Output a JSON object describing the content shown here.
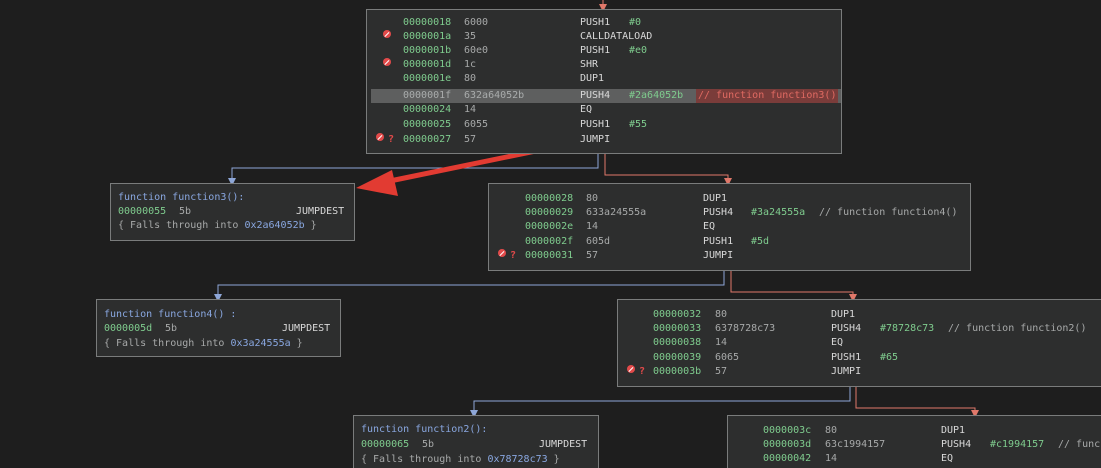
{
  "block1": {
    "rows": [
      {
        "addr": "00000018",
        "bytes": "6000",
        "mnem": "PUSH1",
        "op": "#0"
      },
      {
        "addr": "0000001a",
        "bytes": "35",
        "mnem": "CALLDATALOAD",
        "op": ""
      },
      {
        "addr": "0000001b",
        "bytes": "60e0",
        "mnem": "PUSH1",
        "op": "#e0"
      },
      {
        "addr": "0000001d",
        "bytes": "1c",
        "mnem": "SHR",
        "op": ""
      },
      {
        "addr": "0000001e",
        "bytes": "80",
        "mnem": "DUP1",
        "op": ""
      },
      {
        "addr": "0000001f",
        "bytes": "632a64052b",
        "mnem": "PUSH4",
        "op": "#2a64052b",
        "comment": "// function function3()"
      },
      {
        "addr": "00000024",
        "bytes": "14",
        "mnem": "EQ",
        "op": ""
      },
      {
        "addr": "00000025",
        "bytes": "6055",
        "mnem": "PUSH1",
        "op": "#55"
      },
      {
        "addr": "00000027",
        "bytes": "57",
        "mnem": "JUMPI",
        "op": ""
      }
    ]
  },
  "block2": {
    "rows": [
      {
        "addr": "00000028",
        "bytes": "80",
        "mnem": "DUP1",
        "op": ""
      },
      {
        "addr": "00000029",
        "bytes": "633a24555a",
        "mnem": "PUSH4",
        "op": "#3a24555a",
        "comment": "// function function4()"
      },
      {
        "addr": "0000002e",
        "bytes": "14",
        "mnem": "EQ",
        "op": ""
      },
      {
        "addr": "0000002f",
        "bytes": "605d",
        "mnem": "PUSH1",
        "op": "#5d"
      },
      {
        "addr": "00000031",
        "bytes": "57",
        "mnem": "JUMPI",
        "op": ""
      }
    ]
  },
  "block3": {
    "rows": [
      {
        "addr": "00000032",
        "bytes": "80",
        "mnem": "DUP1",
        "op": ""
      },
      {
        "addr": "00000033",
        "bytes": "6378728c73",
        "mnem": "PUSH4",
        "op": "#78728c73",
        "comment": "// function function2()"
      },
      {
        "addr": "00000038",
        "bytes": "14",
        "mnem": "EQ",
        "op": ""
      },
      {
        "addr": "00000039",
        "bytes": "6065",
        "mnem": "PUSH1",
        "op": "#65"
      },
      {
        "addr": "0000003b",
        "bytes": "57",
        "mnem": "JUMPI",
        "op": ""
      }
    ]
  },
  "block4": {
    "rows": [
      {
        "addr": "0000003c",
        "bytes": "80",
        "mnem": "DUP1",
        "op": ""
      },
      {
        "addr": "0000003d",
        "bytes": "63c1994157",
        "mnem": "PUSH4",
        "op": "#c1994157",
        "comment": "// func"
      },
      {
        "addr": "00000042",
        "bytes": "14",
        "mnem": "EQ",
        "op": ""
      }
    ]
  },
  "fn3": {
    "header": "function function3():",
    "addr": "00000055",
    "bytes": "5b",
    "mnem": "JUMPDEST",
    "falls_prefix": "{ Falls through into ",
    "falls_target": "0x2a64052b",
    "falls_suffix": " }"
  },
  "fn4": {
    "header": "function function4() :",
    "addr": "0000005d",
    "bytes": "5b",
    "mnem": "JUMPDEST",
    "falls_prefix": "{ Falls through into ",
    "falls_target": "0x3a24555a",
    "falls_suffix": " }"
  },
  "fn2": {
    "header": "function function2():",
    "addr": "00000065",
    "bytes": "5b",
    "mnem": "JUMPDEST",
    "falls_prefix": "{ Falls through into ",
    "falls_target": "0x78728c73",
    "falls_suffix": " }"
  },
  "colors": {
    "background": "#1e1e1e",
    "node_bg": "#2d2e2e",
    "address_green": "#7fcc8e",
    "function_blue": "#89a7e0",
    "edge_true": "#8ea7d8",
    "edge_false": "#e0786a",
    "annotation_arrow": "#e23b32"
  }
}
